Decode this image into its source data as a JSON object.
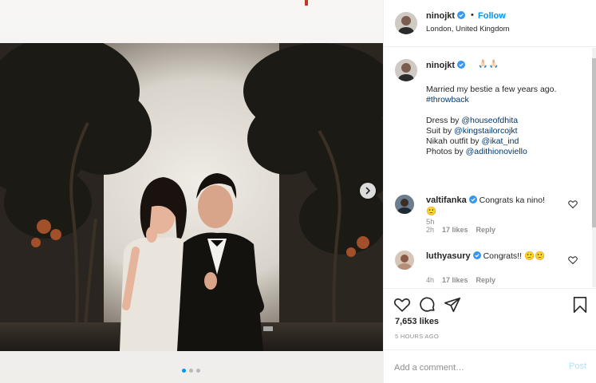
{
  "header": {
    "username": "ninojkt",
    "separator": "•",
    "follow_label": "Follow",
    "location": "London, United Kingdom"
  },
  "caption": {
    "username": "ninojkt",
    "emoji": "🙏🏻🙏🏻",
    "line1": "Married my bestie a few years ago.",
    "hashtag": "#throwback",
    "credits": [
      {
        "prefix": "Dress by ",
        "handle": "@houseofdhita"
      },
      {
        "prefix": "Suit by ",
        "handle": "@kingstailorcojkt"
      },
      {
        "prefix": "Nikah outfit by ",
        "handle": "@ikat_ind"
      },
      {
        "prefix": "Photos by ",
        "handle": "@adithionoviello"
      }
    ],
    "time": "5h"
  },
  "comments": [
    {
      "username": "valtifanka",
      "text": "Congrats ka nino!",
      "emoji": "🙂",
      "time": "2h",
      "likes": "17 likes",
      "reply": "Reply"
    },
    {
      "username": "luthyasury",
      "text": "Congrats!!",
      "emoji": "🙂🙂",
      "time": "4h",
      "likes": "17 likes",
      "reply": "Reply"
    }
  ],
  "stats": {
    "likes": "7,653 likes",
    "date": "5 HOURS AGO"
  },
  "composer": {
    "placeholder": "Add a comment…",
    "post_label": "Post"
  },
  "carousel": {
    "count": 3,
    "active_index": 0
  },
  "colors": {
    "accent": "#0095f6",
    "link": "#00376b",
    "muted": "#8e8e8e",
    "post_disabled": "#b2dffc"
  },
  "icons": [
    "verified-badge-icon",
    "chevron-right-icon",
    "heart-icon",
    "comment-icon",
    "share-icon",
    "bookmark-icon"
  ]
}
